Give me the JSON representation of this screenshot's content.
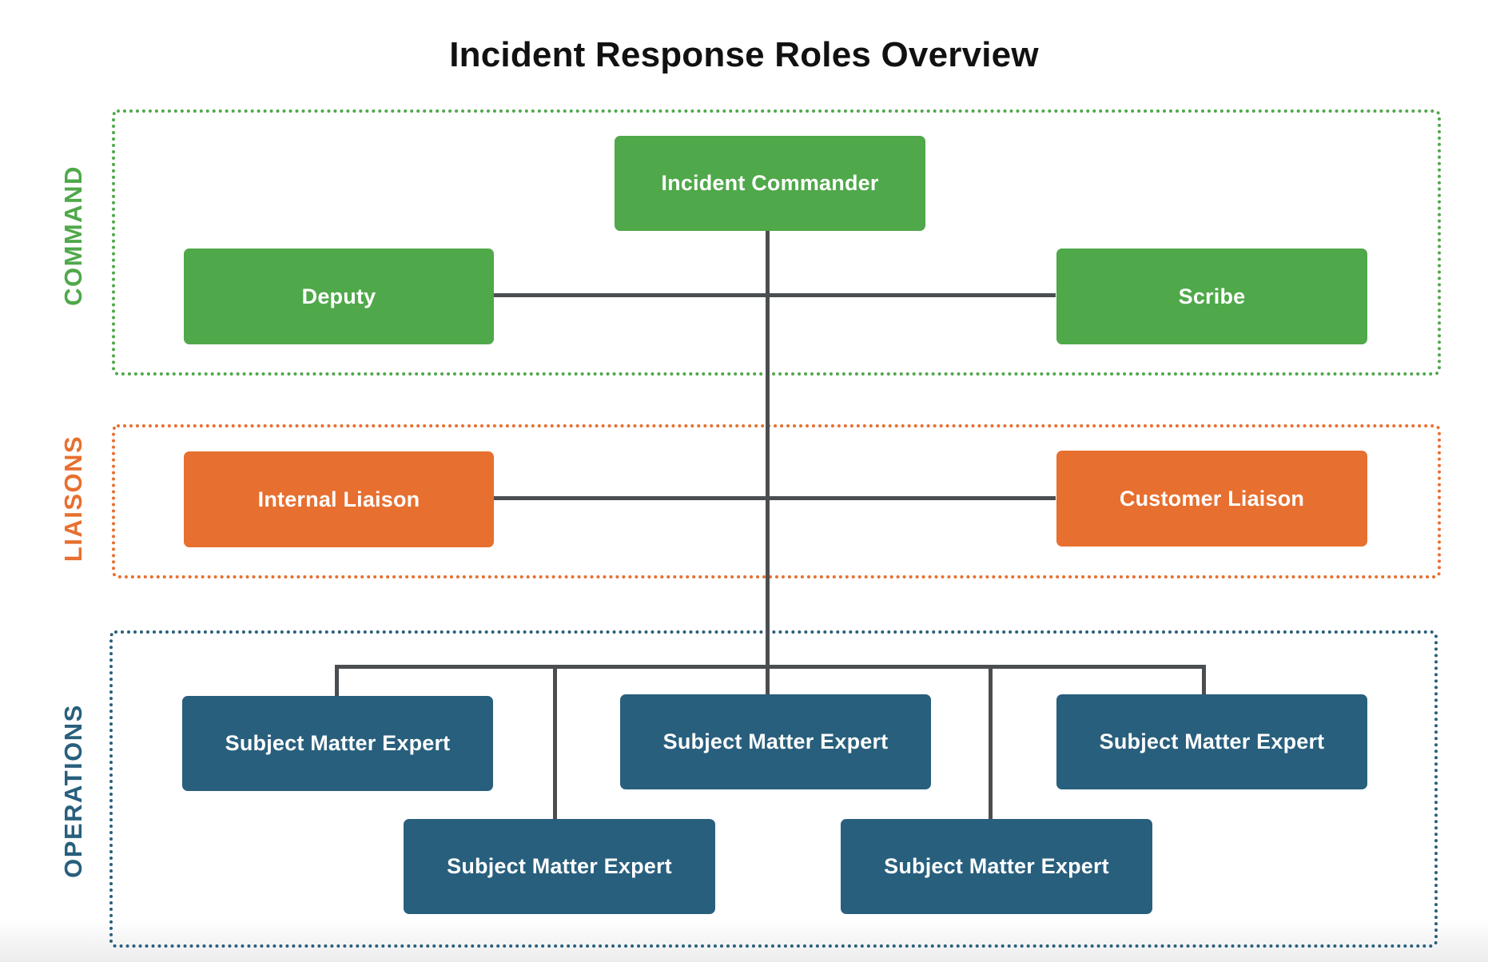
{
  "title": "Incident Response Roles Overview",
  "colors": {
    "command": "#4fa84a",
    "liaisons": "#e76f2f",
    "operations": "#285f7d",
    "connector": "#4b4e51"
  },
  "sections": {
    "command": {
      "label": "COMMAND",
      "nodes": {
        "incident_commander": "Incident Commander",
        "deputy": "Deputy",
        "scribe": "Scribe"
      }
    },
    "liaisons": {
      "label": "LIAISONS",
      "nodes": {
        "internal_liaison": "Internal Liaison",
        "customer_liaison": "Customer Liaison"
      }
    },
    "operations": {
      "label": "OPERATIONS",
      "nodes": [
        "Subject Matter Expert",
        "Subject Matter Expert",
        "Subject Matter Expert",
        "Subject Matter Expert",
        "Subject Matter Expert"
      ]
    }
  }
}
